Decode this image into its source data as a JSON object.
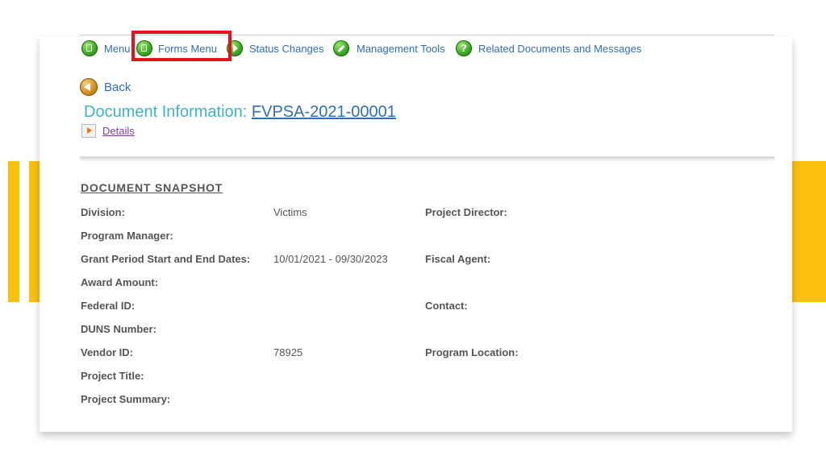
{
  "nav": {
    "items": [
      {
        "label": "Menu",
        "icon": "document-icon"
      },
      {
        "label": "Forms Menu",
        "icon": "document-icon"
      },
      {
        "label": "Status Changes",
        "icon": "arrow-right-icon"
      },
      {
        "label": "Management Tools",
        "icon": "tools-icon"
      },
      {
        "label": "Related Documents and Messages",
        "icon": "question-icon"
      }
    ],
    "highlighted": "Forms Menu"
  },
  "back_label": "Back",
  "document": {
    "heading_prefix": "Document Information:",
    "id": "FVPSA-2021-00001",
    "details_label": "Details"
  },
  "snapshot": {
    "title": "DOCUMENT SNAPSHOT",
    "division_label": "Division:",
    "division_value": "Victims",
    "project_director_label": "Project Director:",
    "program_manager_label": "Program Manager:",
    "grant_period_label": "Grant Period Start and End Dates:",
    "grant_period_value": "10/01/2021 - 09/30/2023",
    "fiscal_agent_label": "Fiscal Agent:",
    "award_amount_label": "Award Amount:",
    "federal_id_label": "Federal ID:",
    "contact_label": "Contact:",
    "duns_label": "DUNS Number:",
    "vendor_id_label": "Vendor ID:",
    "vendor_id_value": "78925",
    "program_location_label": "Program Location:",
    "project_title_label": "Project Title:",
    "project_summary_label": "Project Summary:"
  },
  "colors": {
    "accent_yellow": "#fbc00e",
    "link_blue": "#2f6fb5",
    "heading_teal": "#3bb4c6",
    "highlight_red": "#e3131b"
  }
}
